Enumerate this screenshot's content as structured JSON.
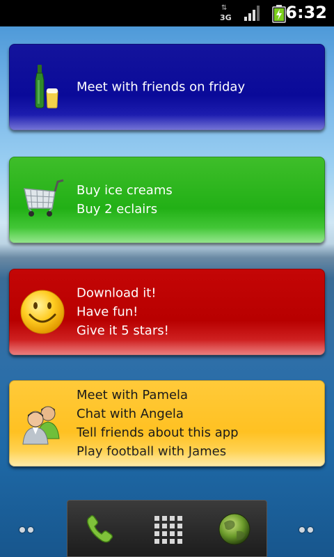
{
  "status_bar": {
    "network_label": "3G",
    "time": "6:32"
  },
  "widgets": [
    {
      "color": "#0a0a99",
      "icon": "bottle-and-beer-icon",
      "lines": [
        "Meet with friends on friday"
      ]
    },
    {
      "color": "#22b016",
      "icon": "shopping-cart-icon",
      "lines": [
        "Buy ice creams",
        "Buy 2 eclairs"
      ]
    },
    {
      "color": "#b80000",
      "icon": "smiley-icon",
      "lines": [
        "Download it!",
        "Have fun!",
        "Give it 5 stars!"
      ]
    },
    {
      "color": "#ffc122",
      "icon": "people-icon",
      "lines": [
        "Meet with Pamela",
        "Chat with Angela",
        "Tell friends about this app",
        "Play football with James"
      ]
    }
  ],
  "dock": {
    "items": [
      "phone-icon",
      "app-drawer-icon",
      "browser-globe-icon"
    ]
  }
}
